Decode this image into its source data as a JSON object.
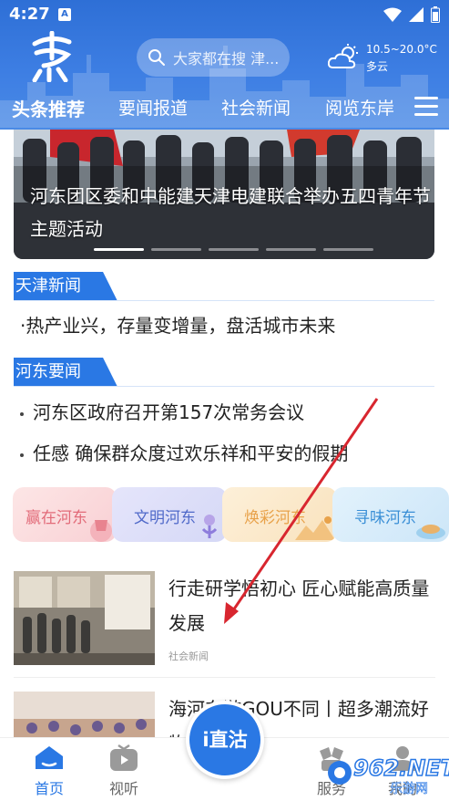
{
  "status_bar": {
    "time": "4:27",
    "notification_glyph": "A"
  },
  "header": {
    "search_placeholder": "大家都在搜 津...",
    "weather": {
      "temp_range": "10.5~20.0°C",
      "condition": "多云"
    },
    "tabs": [
      {
        "label": "头条推荐",
        "active": true
      },
      {
        "label": "要闻报道",
        "active": false
      },
      {
        "label": "社会新闻",
        "active": false
      },
      {
        "label": "阅览东岸",
        "active": false
      }
    ]
  },
  "banner": {
    "caption": "河东团区委和中能建天津电建联合举办五四青年节主题活动",
    "slide_count": 5,
    "active_slide": 1
  },
  "sections": [
    {
      "label": "天津新闻",
      "items": [
        "·热产业兴，存量变增量，盘活城市未来"
      ]
    },
    {
      "label": "河东要闻",
      "items": [
        "河东区政府召开第157次常务会议",
        "任感 确保群众度过欢乐祥和平安的假期"
      ]
    }
  ],
  "feature_cards": [
    {
      "label": "赢在河东",
      "color": "#e8838f"
    },
    {
      "label": "文明河东",
      "color": "#4f69c9"
    },
    {
      "label": "焕彩河东",
      "color": "#e8a24a"
    },
    {
      "label": "寻味河东",
      "color": "#3a8fd6"
    }
  ],
  "articles": [
    {
      "title": "行走研学悟初心 匠心赋能高质量发展",
      "category": "社会新闻"
    },
    {
      "title": "海河东游GOU不同丨超多潮流好物等你来",
      "category": ""
    }
  ],
  "bottom_nav": {
    "items": [
      {
        "label": "首页",
        "active": true
      },
      {
        "label": "视听",
        "active": false
      },
      {
        "label": "服务",
        "active": false
      },
      {
        "label": "我的",
        "active": false
      }
    ],
    "fab_label": "i直沽"
  },
  "watermark": {
    "main": "962.NET",
    "sub": "乐游网"
  },
  "colors": {
    "primary": "#2a78e4",
    "header_bg": "#3d7ee3"
  }
}
